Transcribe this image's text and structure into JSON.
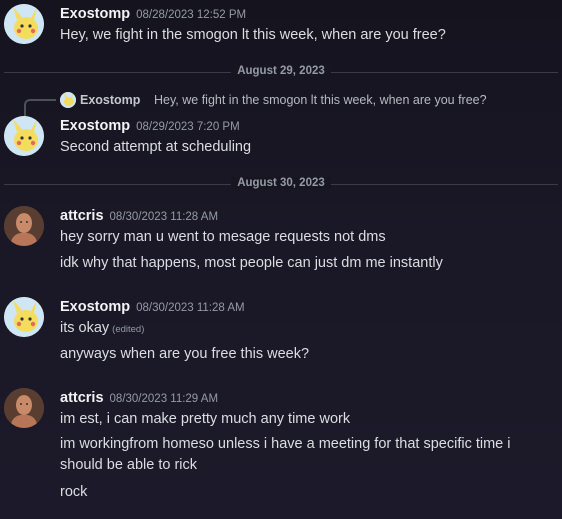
{
  "messages": [
    {
      "author": "Exostomp",
      "timestamp": "08/28/2023 12:52 PM",
      "lines": [
        "Hey, we fight in the smogon lt this week, when are you free?"
      ]
    },
    {
      "author": "Exostomp",
      "timestamp": "08/29/2023 7:20 PM",
      "lines": [
        "Second attempt at scheduling"
      ]
    },
    {
      "author": "attcris",
      "timestamp": "08/30/2023 11:28 AM",
      "lines": [
        "hey sorry man u went to mesage requests not dms",
        "idk why that happens, most people can just dm me instantly"
      ]
    },
    {
      "author": "Exostomp",
      "timestamp": "08/30/2023 11:28 AM",
      "lines": [
        "its okay",
        "anyways when are you free this week?"
      ],
      "edited_label": "(edited)"
    },
    {
      "author": "attcris",
      "timestamp": "08/30/2023 11:29 AM",
      "lines": [
        "im est, i can make pretty much any time work",
        "im workingfrom homeso unless i have a meeting for that specific time i should be able to rick",
        "rock"
      ]
    }
  ],
  "dividers": [
    "August 29, 2023",
    "August 30, 2023"
  ],
  "reply": {
    "author": "Exostomp",
    "text": "Hey, we fight in the smogon lt this week, when are you free?"
  },
  "colors": {
    "background": "#1a1826",
    "username": "#f2f3f5",
    "text": "#dbdee1",
    "muted": "#949ba4"
  },
  "icons": {
    "exostomp_avatar": "pikachu-avatar-icon",
    "attcris_avatar": "person-avatar-icon"
  }
}
